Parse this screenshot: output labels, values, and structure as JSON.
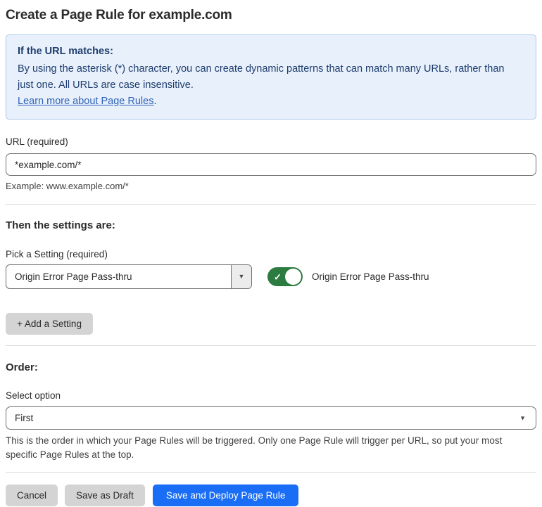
{
  "page": {
    "title": "Create a Page Rule for example.com"
  },
  "info_box": {
    "heading": "If the URL matches:",
    "body": "By using the asterisk (*) character, you can create dynamic patterns that can match many URLs, rather than just one. All URLs are case insensitive.",
    "link_label": "Learn more about Page Rules",
    "link_suffix": "."
  },
  "url_field": {
    "label": "URL (required)",
    "value": "*example.com/*",
    "helper": "Example: www.example.com/*"
  },
  "settings_section": {
    "heading": "Then the settings are:",
    "picker_label": "Pick a Setting (required)",
    "picker_value": "Origin Error Page Pass-thru",
    "toggle_state": "on",
    "toggle_label": "Origin Error Page Pass-thru",
    "add_setting_label": "+ Add a Setting"
  },
  "order_section": {
    "heading": "Order:",
    "select_label": "Select option",
    "select_value": "First",
    "helper": "This is the order in which your Page Rules will be triggered. Only one Page Rule will trigger per URL, so put your most specific Page Rules at the top."
  },
  "footer": {
    "cancel_label": "Cancel",
    "save_draft_label": "Save as Draft",
    "save_deploy_label": "Save and Deploy Page Rule"
  },
  "icons": {
    "dropdown_arrow": "▼",
    "toggle_check": "✓"
  },
  "colors": {
    "accent_blue": "#1a6ef5",
    "toggle_green": "#2c7b41",
    "info_box_bg": "#e8f1fb",
    "info_box_border": "#a9c9ea",
    "info_text_navy": "#1e3c6e",
    "link_blue": "#2f62b8",
    "button_gray": "#d4d4d4"
  }
}
